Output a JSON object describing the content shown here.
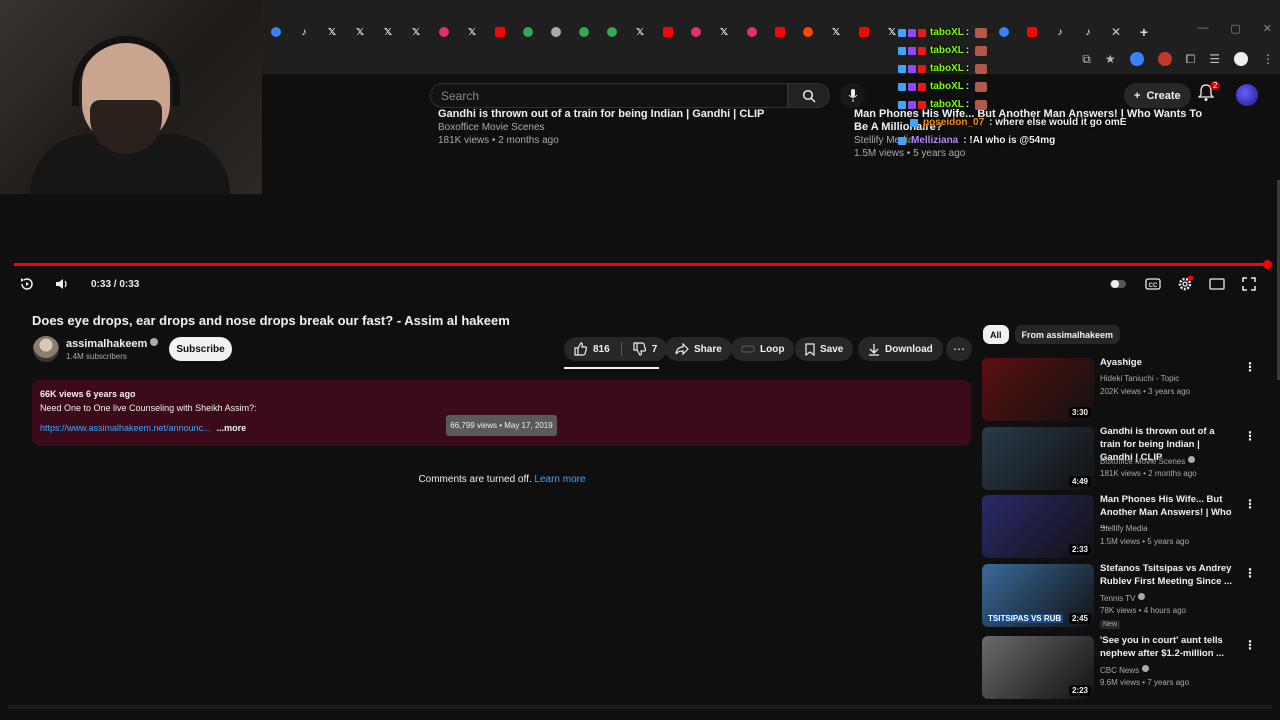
{
  "browser": {
    "tabs": [
      {
        "icon": "edge-icon",
        "color": "#3b82f6"
      },
      {
        "icon": "tiktok-icon",
        "color": "#ffffff"
      },
      {
        "icon": "x-icon",
        "color": "#ffffff"
      },
      {
        "icon": "x-icon",
        "color": "#ffffff"
      },
      {
        "icon": "x-icon",
        "color": "#ffffff"
      },
      {
        "icon": "x-icon",
        "color": "#ffffff"
      },
      {
        "icon": "instagram-icon",
        "color": "#e1306c"
      },
      {
        "icon": "x-icon",
        "color": "#ffffff"
      },
      {
        "icon": "youtube-icon",
        "color": "#ff0000"
      },
      {
        "icon": "chrome-icon",
        "color": "#34a853"
      },
      {
        "icon": "globe-icon",
        "color": "#aaaaaa"
      },
      {
        "icon": "chrome-icon",
        "color": "#34a853"
      },
      {
        "icon": "chrome-icon",
        "color": "#34a853"
      },
      {
        "icon": "x-icon",
        "color": "#ffffff"
      },
      {
        "icon": "youtube-icon",
        "color": "#ff0000"
      },
      {
        "icon": "instagram-icon",
        "color": "#e1306c"
      },
      {
        "icon": "x-icon",
        "color": "#ffffff"
      },
      {
        "icon": "instagram-icon",
        "color": "#e1306c"
      },
      {
        "icon": "youtube-icon",
        "color": "#ff0000"
      },
      {
        "icon": "reddit-icon",
        "color": "#ff4500"
      },
      {
        "icon": "x-icon",
        "color": "#ffffff"
      },
      {
        "icon": "youtube-icon",
        "color": "#ff0000"
      },
      {
        "icon": "x-icon",
        "color": "#ffffff"
      }
    ],
    "tabs_after_chat": [
      {
        "icon": "edge-icon",
        "color": "#3b82f6"
      },
      {
        "icon": "youtube-icon",
        "color": "#ff0000"
      },
      {
        "icon": "tiktok-icon",
        "color": "#ffffff"
      },
      {
        "icon": "tiktok-icon",
        "color": "#ffffff"
      }
    ],
    "close_glyph": "✕",
    "new_tab_glyph": "+"
  },
  "header": {
    "search_placeholder": "Search",
    "create_label": "Create",
    "notification_count": "2"
  },
  "end_screen": {
    "left": {
      "title": "Gandhi is thrown out of a train for being Indian | Gandhi | CLIP",
      "channel": "Boxoffice Movie Scenes",
      "meta": "181K views • 2 months ago"
    },
    "right": {
      "title": "Man Phones His Wife... But Another Man Answers! | Who Wants To Be A Millionaire?",
      "channel": "Stellify Media",
      "meta": "1.5M views • 5 years ago"
    }
  },
  "chat": {
    "messages": [
      {
        "user": "taboXL",
        "text": ":",
        "color": "#7fff00"
      },
      {
        "user": "taboXL",
        "text": ":",
        "color": "#7fff00"
      },
      {
        "user": "taboXL",
        "text": ":",
        "color": "#7fff00"
      },
      {
        "user": "taboXL",
        "text": ":",
        "color": "#7fff00"
      },
      {
        "user": "taboXL",
        "text": ":",
        "color": "#7fff00"
      }
    ],
    "extra": [
      {
        "user": "poseidon_07",
        "text": ": where else would it go omE",
        "color": "#ff8c00"
      },
      {
        "user": "Melliziana",
        "text": ": !AI who is @54mg",
        "color": "#b48cff"
      }
    ]
  },
  "player": {
    "time": "0:33 / 0:33",
    "progress": 1.0
  },
  "video": {
    "title": "Does eye drops, ear drops and nose drops break our fast? - Assim al hakeem",
    "channel": "assimalhakeem",
    "subscribers": "1.4M subscribers",
    "subscribe_label": "Subscribe",
    "likes": "816",
    "dislikes": "7",
    "share_label": "Share",
    "loop_label": "Loop",
    "save_label": "Save",
    "download_label": "Download"
  },
  "description": {
    "meta": "66K views  6 years ago",
    "line1": "Need One to One live Counseling with Sheikh Assim?:",
    "link": "https://www.assimalhakeem.net/announc...",
    "more": "...more",
    "tooltip": "66,799 views • May 17, 2019"
  },
  "comments": {
    "text": "Comments are turned off.",
    "learn_more": "Learn more"
  },
  "sidebar": {
    "chips": [
      {
        "label": "All",
        "active": true
      },
      {
        "label": "From assimalhakeem",
        "active": false
      }
    ],
    "recommendations": [
      {
        "title": "Ayashige",
        "channel": "Hideki Taniuchi - Topic",
        "meta": "202K views • 3 years ago",
        "duration": "3:30",
        "thumb": "#5a1010",
        "verified": false,
        "new": ""
      },
      {
        "title": "Gandhi is thrown out of a train for being Indian | Gandhi | CLIP",
        "channel": "Boxoffice Movie Scenes",
        "meta": "181K views • 2 months ago",
        "duration": "4:49",
        "thumb": "#2a3a4a",
        "verified": true,
        "new": ""
      },
      {
        "title": "Man Phones His Wife... But Another Man Answers! | Who ...",
        "channel": "Stellify Media",
        "meta": "1.5M views • 5 years ago",
        "duration": "2:33",
        "thumb": "#2a2a6a",
        "verified": false,
        "new": ""
      },
      {
        "title": "Stefanos Tsitsipas vs Andrey Rublev First Meeting Since ...",
        "channel": "Tennis TV",
        "meta": "78K views • 4 hours ago",
        "duration": "2:45",
        "thumb": "#3a6a9a",
        "verified": true,
        "new": "New"
      },
      {
        "title": "'See you in court' aunt tells nephew after $1.2-million ...",
        "channel": "CBC News",
        "meta": "9.6M views • 7 years ago",
        "duration": "2:23",
        "thumb": "#6a6a6a",
        "verified": true,
        "new": ""
      }
    ],
    "thumb_overlays": [
      "",
      "",
      "",
      "TSITSIPAS VS RUB",
      ""
    ]
  }
}
